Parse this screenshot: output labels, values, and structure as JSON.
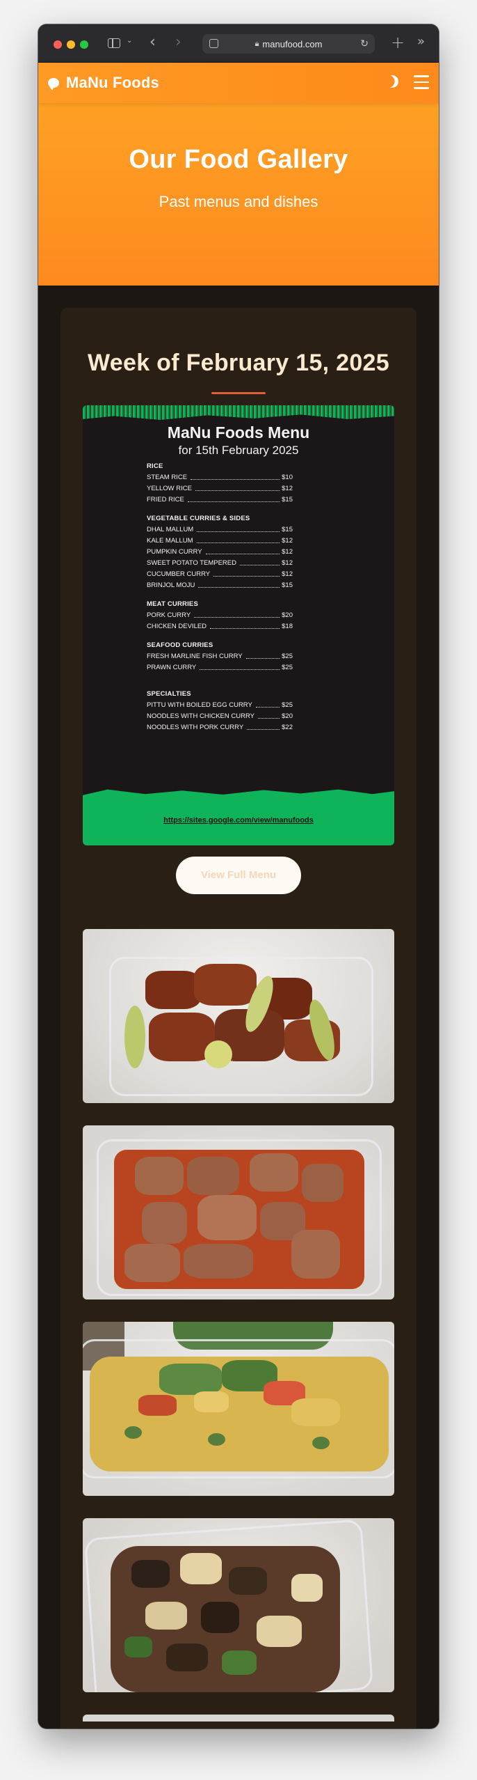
{
  "browser": {
    "url": "manufood.com"
  },
  "site": {
    "brand": "MaNu Foods"
  },
  "hero": {
    "title": "Our Food Gallery",
    "subtitle": "Past menus and dishes"
  },
  "gallery": {
    "week_title": "Week of February 15, 2025",
    "view_button": "View Full Menu"
  },
  "menu": {
    "title": "MaNu Foods Menu",
    "subtitle": "for 15th February 2025",
    "sections": [
      {
        "title": "RICE",
        "items": [
          {
            "name": "STEAM RICE",
            "price": "$10"
          },
          {
            "name": "YELLOW RICE",
            "price": "$12"
          },
          {
            "name": "FRIED RICE",
            "price": "$15"
          }
        ]
      },
      {
        "title": "VEGETABLE CURRIES & SIDES",
        "items": [
          {
            "name": "DHAL MALLUM",
            "price": "$15"
          },
          {
            "name": "KALE MALLUM",
            "price": "$12"
          },
          {
            "name": "PUMPKIN CURRY",
            "price": "$12"
          },
          {
            "name": "SWEET POTATO TEMPERED",
            "price": "$12"
          },
          {
            "name": "CUCUMBER CURRY",
            "price": "$12"
          },
          {
            "name": "BRINJOL MOJU",
            "price": "$15"
          }
        ]
      },
      {
        "title": "MEAT CURRIES",
        "items": [
          {
            "name": "PORK CURRY",
            "price": "$20"
          },
          {
            "name": "CHICKEN DEVILED",
            "price": "$18"
          }
        ]
      },
      {
        "title": "SEAFOOD CURRIES",
        "items": [
          {
            "name": "FRESH MARLINE FISH  CURRY",
            "price": "$25"
          },
          {
            "name": "PRAWN CURRY",
            "price": "$25"
          }
        ]
      },
      {
        "title": "SPECIALTIES",
        "items": [
          {
            "name": "PITTU WITH BOILED EGG CURRY",
            "price": "$25"
          },
          {
            "name": "NOODLES WITH CHICKEN CURRY",
            "price": "$20"
          },
          {
            "name": "NOODLES WITH PORK CURRY",
            "price": "$22"
          }
        ]
      }
    ],
    "link": "https://sites.google.com/view/manufoods"
  }
}
